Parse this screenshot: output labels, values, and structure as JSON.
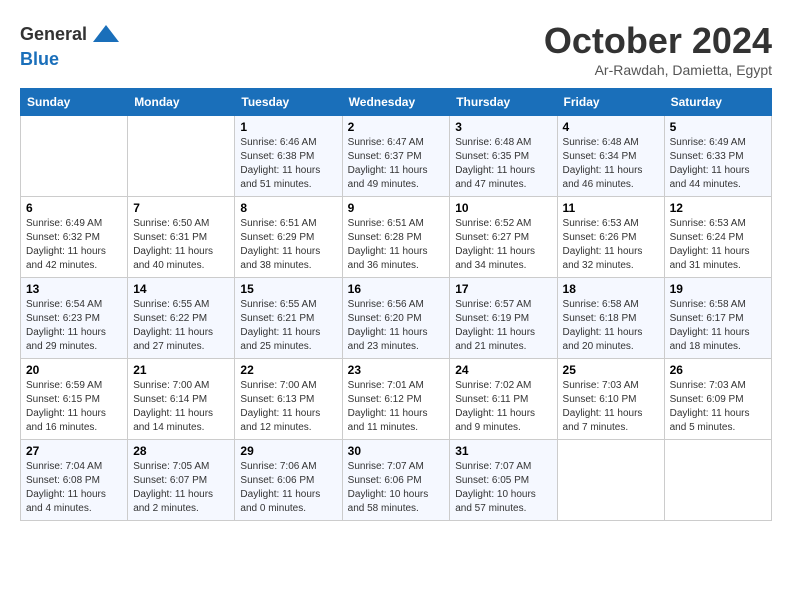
{
  "header": {
    "logo_line1": "General",
    "logo_line2": "Blue",
    "month": "October 2024",
    "location": "Ar-Rawdah, Damietta, Egypt"
  },
  "weekdays": [
    "Sunday",
    "Monday",
    "Tuesday",
    "Wednesday",
    "Thursday",
    "Friday",
    "Saturday"
  ],
  "weeks": [
    [
      {
        "day": "",
        "sunrise": "",
        "sunset": "",
        "daylight": ""
      },
      {
        "day": "",
        "sunrise": "",
        "sunset": "",
        "daylight": ""
      },
      {
        "day": "1",
        "sunrise": "Sunrise: 6:46 AM",
        "sunset": "Sunset: 6:38 PM",
        "daylight": "Daylight: 11 hours and 51 minutes."
      },
      {
        "day": "2",
        "sunrise": "Sunrise: 6:47 AM",
        "sunset": "Sunset: 6:37 PM",
        "daylight": "Daylight: 11 hours and 49 minutes."
      },
      {
        "day": "3",
        "sunrise": "Sunrise: 6:48 AM",
        "sunset": "Sunset: 6:35 PM",
        "daylight": "Daylight: 11 hours and 47 minutes."
      },
      {
        "day": "4",
        "sunrise": "Sunrise: 6:48 AM",
        "sunset": "Sunset: 6:34 PM",
        "daylight": "Daylight: 11 hours and 46 minutes."
      },
      {
        "day": "5",
        "sunrise": "Sunrise: 6:49 AM",
        "sunset": "Sunset: 6:33 PM",
        "daylight": "Daylight: 11 hours and 44 minutes."
      }
    ],
    [
      {
        "day": "6",
        "sunrise": "Sunrise: 6:49 AM",
        "sunset": "Sunset: 6:32 PM",
        "daylight": "Daylight: 11 hours and 42 minutes."
      },
      {
        "day": "7",
        "sunrise": "Sunrise: 6:50 AM",
        "sunset": "Sunset: 6:31 PM",
        "daylight": "Daylight: 11 hours and 40 minutes."
      },
      {
        "day": "8",
        "sunrise": "Sunrise: 6:51 AM",
        "sunset": "Sunset: 6:29 PM",
        "daylight": "Daylight: 11 hours and 38 minutes."
      },
      {
        "day": "9",
        "sunrise": "Sunrise: 6:51 AM",
        "sunset": "Sunset: 6:28 PM",
        "daylight": "Daylight: 11 hours and 36 minutes."
      },
      {
        "day": "10",
        "sunrise": "Sunrise: 6:52 AM",
        "sunset": "Sunset: 6:27 PM",
        "daylight": "Daylight: 11 hours and 34 minutes."
      },
      {
        "day": "11",
        "sunrise": "Sunrise: 6:53 AM",
        "sunset": "Sunset: 6:26 PM",
        "daylight": "Daylight: 11 hours and 32 minutes."
      },
      {
        "day": "12",
        "sunrise": "Sunrise: 6:53 AM",
        "sunset": "Sunset: 6:24 PM",
        "daylight": "Daylight: 11 hours and 31 minutes."
      }
    ],
    [
      {
        "day": "13",
        "sunrise": "Sunrise: 6:54 AM",
        "sunset": "Sunset: 6:23 PM",
        "daylight": "Daylight: 11 hours and 29 minutes."
      },
      {
        "day": "14",
        "sunrise": "Sunrise: 6:55 AM",
        "sunset": "Sunset: 6:22 PM",
        "daylight": "Daylight: 11 hours and 27 minutes."
      },
      {
        "day": "15",
        "sunrise": "Sunrise: 6:55 AM",
        "sunset": "Sunset: 6:21 PM",
        "daylight": "Daylight: 11 hours and 25 minutes."
      },
      {
        "day": "16",
        "sunrise": "Sunrise: 6:56 AM",
        "sunset": "Sunset: 6:20 PM",
        "daylight": "Daylight: 11 hours and 23 minutes."
      },
      {
        "day": "17",
        "sunrise": "Sunrise: 6:57 AM",
        "sunset": "Sunset: 6:19 PM",
        "daylight": "Daylight: 11 hours and 21 minutes."
      },
      {
        "day": "18",
        "sunrise": "Sunrise: 6:58 AM",
        "sunset": "Sunset: 6:18 PM",
        "daylight": "Daylight: 11 hours and 20 minutes."
      },
      {
        "day": "19",
        "sunrise": "Sunrise: 6:58 AM",
        "sunset": "Sunset: 6:17 PM",
        "daylight": "Daylight: 11 hours and 18 minutes."
      }
    ],
    [
      {
        "day": "20",
        "sunrise": "Sunrise: 6:59 AM",
        "sunset": "Sunset: 6:15 PM",
        "daylight": "Daylight: 11 hours and 16 minutes."
      },
      {
        "day": "21",
        "sunrise": "Sunrise: 7:00 AM",
        "sunset": "Sunset: 6:14 PM",
        "daylight": "Daylight: 11 hours and 14 minutes."
      },
      {
        "day": "22",
        "sunrise": "Sunrise: 7:00 AM",
        "sunset": "Sunset: 6:13 PM",
        "daylight": "Daylight: 11 hours and 12 minutes."
      },
      {
        "day": "23",
        "sunrise": "Sunrise: 7:01 AM",
        "sunset": "Sunset: 6:12 PM",
        "daylight": "Daylight: 11 hours and 11 minutes."
      },
      {
        "day": "24",
        "sunrise": "Sunrise: 7:02 AM",
        "sunset": "Sunset: 6:11 PM",
        "daylight": "Daylight: 11 hours and 9 minutes."
      },
      {
        "day": "25",
        "sunrise": "Sunrise: 7:03 AM",
        "sunset": "Sunset: 6:10 PM",
        "daylight": "Daylight: 11 hours and 7 minutes."
      },
      {
        "day": "26",
        "sunrise": "Sunrise: 7:03 AM",
        "sunset": "Sunset: 6:09 PM",
        "daylight": "Daylight: 11 hours and 5 minutes."
      }
    ],
    [
      {
        "day": "27",
        "sunrise": "Sunrise: 7:04 AM",
        "sunset": "Sunset: 6:08 PM",
        "daylight": "Daylight: 11 hours and 4 minutes."
      },
      {
        "day": "28",
        "sunrise": "Sunrise: 7:05 AM",
        "sunset": "Sunset: 6:07 PM",
        "daylight": "Daylight: 11 hours and 2 minutes."
      },
      {
        "day": "29",
        "sunrise": "Sunrise: 7:06 AM",
        "sunset": "Sunset: 6:06 PM",
        "daylight": "Daylight: 11 hours and 0 minutes."
      },
      {
        "day": "30",
        "sunrise": "Sunrise: 7:07 AM",
        "sunset": "Sunset: 6:06 PM",
        "daylight": "Daylight: 10 hours and 58 minutes."
      },
      {
        "day": "31",
        "sunrise": "Sunrise: 7:07 AM",
        "sunset": "Sunset: 6:05 PM",
        "daylight": "Daylight: 10 hours and 57 minutes."
      },
      {
        "day": "",
        "sunrise": "",
        "sunset": "",
        "daylight": ""
      },
      {
        "day": "",
        "sunrise": "",
        "sunset": "",
        "daylight": ""
      }
    ]
  ]
}
